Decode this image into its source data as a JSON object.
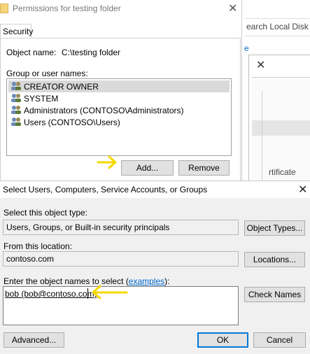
{
  "background_window": {
    "search_text": "earch Local Disk (",
    "partial_text_1": "e",
    "partial_text_2": "rtificate"
  },
  "permissions_dialog": {
    "title": "Permissions for testing folder",
    "tab_security": "Security",
    "object_name_label": "Object name:",
    "object_name_value": "C:\\testing folder",
    "group_label": "Group or user names:",
    "users": [
      {
        "name": "CREATOR OWNER",
        "icon": "user-group-icon"
      },
      {
        "name": "SYSTEM",
        "icon": "user-group-icon"
      },
      {
        "name": "Administrators (CONTOSO\\Administrators)",
        "icon": "user-group-icon"
      },
      {
        "name": "Users (CONTOSO\\Users)",
        "icon": "user-group-icon"
      }
    ],
    "add_button": "Add...",
    "remove_button": "Remove"
  },
  "select_dialog": {
    "title": "Select Users, Computers, Service Accounts, or Groups",
    "object_type_label": "Select this object type:",
    "object_type_value": "Users, Groups, or Built-in security principals",
    "object_types_button": "Object Types...",
    "location_label": "From this location:",
    "location_value": "contoso.com",
    "locations_button": "Locations...",
    "enter_label_prefix": "Enter the object names to select (",
    "enter_label_link": "examples",
    "enter_label_suffix": "):",
    "names_value": "bob (bob@contoso.com)",
    "check_names_button": "Check Names",
    "advanced_button": "Advanced...",
    "ok_button": "OK",
    "cancel_button": "Cancel"
  },
  "colors": {
    "accent": "#0078d7",
    "annotation": "#f5d800",
    "link": "#0066cc",
    "selection": "#d9d9d9"
  }
}
